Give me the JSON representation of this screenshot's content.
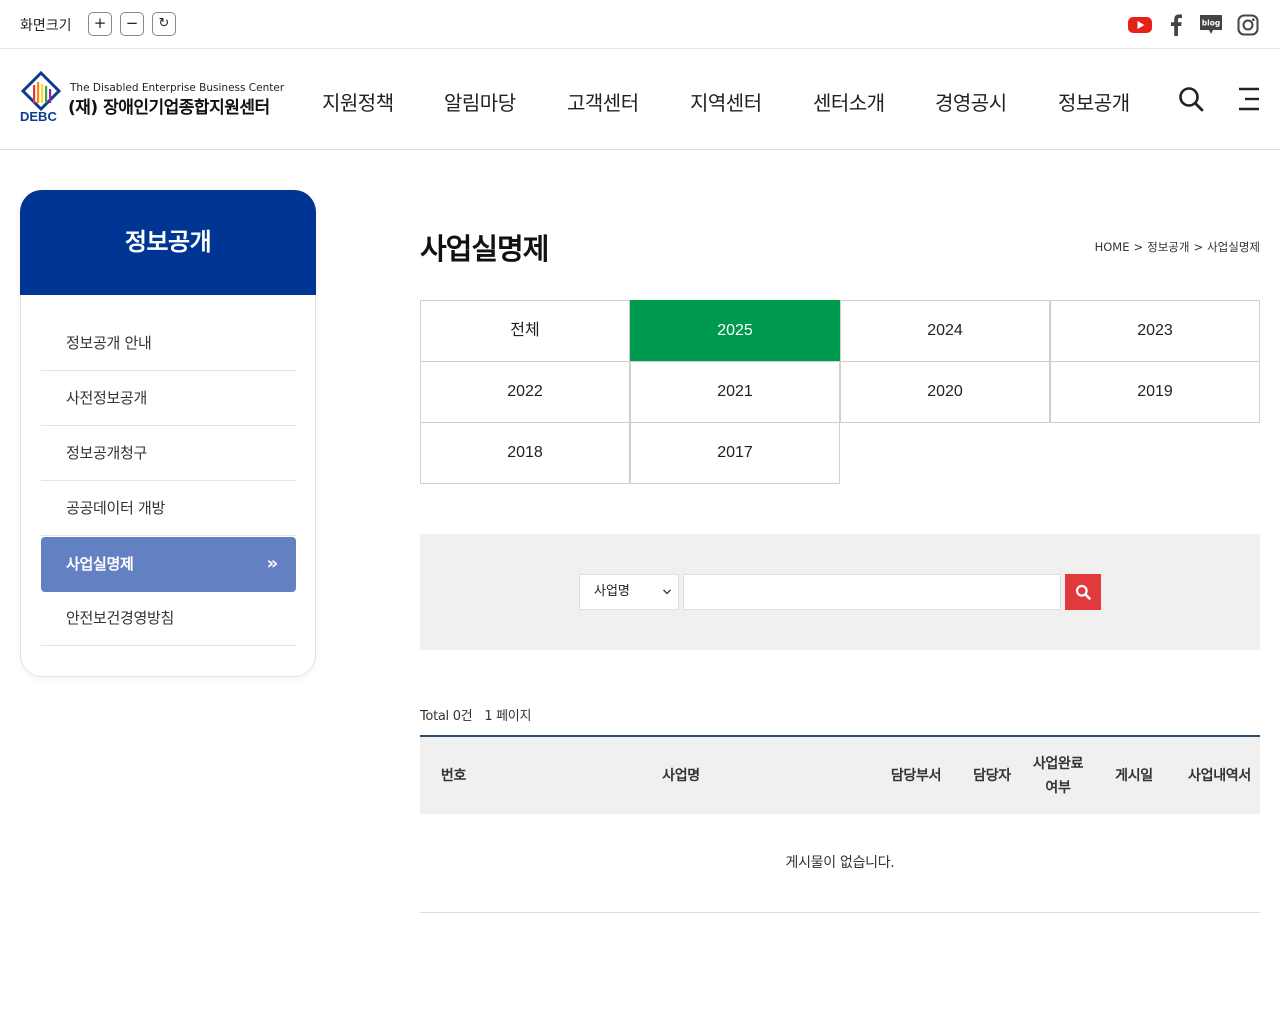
{
  "topbar": {
    "zoom_label": "화면크기",
    "zoom_in": "+",
    "zoom_out": "−",
    "zoom_reset": "↻",
    "social": [
      "youtube-icon",
      "facebook-icon",
      "blog-icon",
      "instagram-icon"
    ],
    "blog_text": "blog"
  },
  "header": {
    "logo_en": "The Disabled Enterprise Business Center",
    "logo_ko": "(재) 장애인기업종합지원센터",
    "logo_abbr": "DEBC",
    "nav": [
      "지원정책",
      "알림마당",
      "고객센터",
      "지역센터",
      "센터소개",
      "경영공시",
      "정보공개"
    ]
  },
  "side": {
    "title": "정보공개",
    "items": [
      "정보공개 안내",
      "사전정보공개",
      "정보공개청구",
      "공공데이터 개방",
      "사업실명제",
      "안전보건경영방침"
    ],
    "active_index": 4,
    "active_arrow": "»"
  },
  "content": {
    "title": "사업실명제",
    "breadcrumb": [
      "HOME",
      "정보공개",
      "사업실명제"
    ],
    "breadcrumb_sep": ">",
    "years": [
      "전체",
      "2025",
      "2024",
      "2023",
      "2022",
      "2021",
      "2020",
      "2019",
      "2018",
      "2017"
    ],
    "active_year": "2025",
    "search": {
      "select_value": "사업명",
      "input_value": ""
    },
    "total": "Total 0건",
    "page": "1 페이지",
    "table": {
      "headers": [
        "번호",
        "사업명",
        "담당부서",
        "담당자",
        "사업완료\n여부",
        "게시일",
        "사업내역서"
      ],
      "empty": "게시물이 없습니다."
    }
  },
  "colors": {
    "brand_blue": "#003593",
    "side_active": "#6380c2",
    "year_active": "#009a4e",
    "search_button": "#e1393c",
    "table_top_border": "#2f4f71"
  }
}
